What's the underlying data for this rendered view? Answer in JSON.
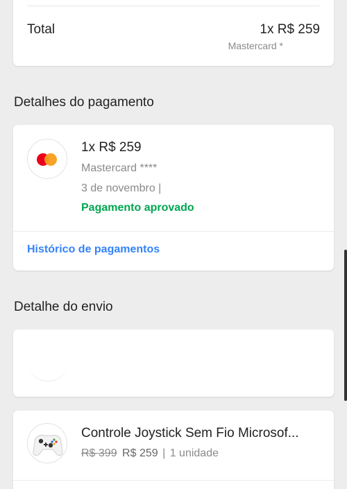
{
  "total": {
    "label": "Total",
    "value": "1x R$ 259",
    "method": "Mastercard *"
  },
  "payment_section": {
    "title": "Detalhes do pagamento",
    "amount": "1x R$ 259",
    "method": "Mastercard ****",
    "date": "3 de novembro  |",
    "status": "Pagamento aprovado",
    "history_link": "Histórico de pagamentos",
    "logo": "mastercard-logo"
  },
  "shipping_section": {
    "title": "Detalhe do envio"
  },
  "product": {
    "name": "Controle Joystick Sem Fio Microsof...",
    "old_price": "R$ 399",
    "price": "R$ 259",
    "separator": "|",
    "quantity": "1 unidade",
    "image": "xbox-controller-image"
  },
  "colors": {
    "approved": "#00a650",
    "link": "#3483fa",
    "background": "#ededed"
  }
}
